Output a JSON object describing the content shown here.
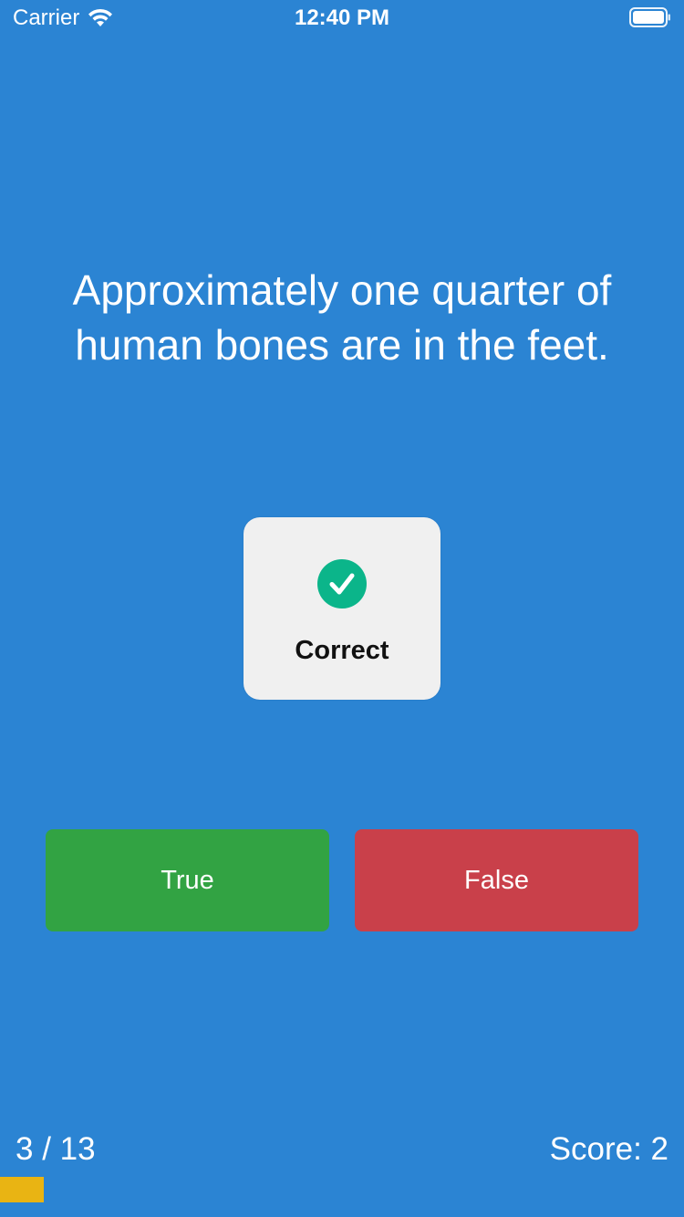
{
  "status_bar": {
    "carrier": "Carrier",
    "time": "12:40 PM"
  },
  "question": {
    "text": "Approximately one quarter of human bones are in the feet."
  },
  "feedback": {
    "label": "Correct",
    "icon": "checkmark-circle-icon",
    "icon_color": "#0bb58a"
  },
  "buttons": {
    "true_label": "True",
    "false_label": "False",
    "true_color": "#32a343",
    "false_color": "#c9404a"
  },
  "footer": {
    "progress_label": "3 / 13",
    "score_label": "Score: 2",
    "progress_current": 3,
    "progress_total": 13,
    "progress_fraction": 0.064,
    "progress_color": "#e9b413"
  },
  "colors": {
    "background": "#2b84d3"
  }
}
